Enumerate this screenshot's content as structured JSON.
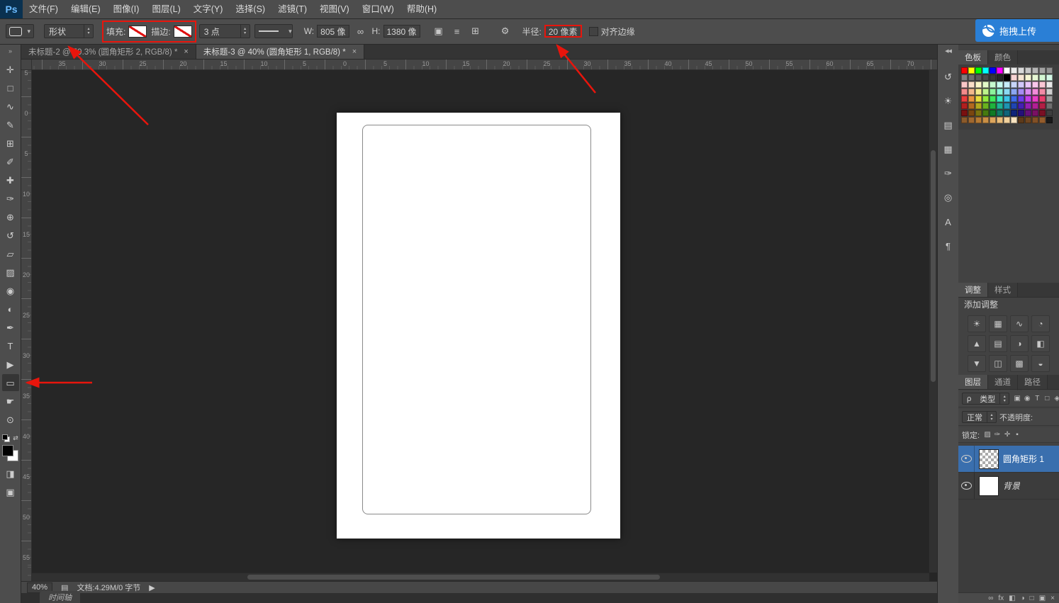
{
  "app": {
    "logo": "Ps",
    "upload_label": "拖拽上传"
  },
  "menu_bar": {
    "items": [
      "文件(F)",
      "编辑(E)",
      "图像(I)",
      "图层(L)",
      "文字(Y)",
      "选择(S)",
      "滤镜(T)",
      "视图(V)",
      "窗口(W)",
      "帮助(H)"
    ]
  },
  "options_bar": {
    "mode_value": "形状",
    "fill_label": "填充:",
    "stroke_label": "描边:",
    "stroke_width_value": "3 点",
    "width_label": "W:",
    "width_value": "805 像",
    "link_glyph": "∞",
    "height_label": "H:",
    "height_value": "1380 像",
    "combine_glyph": "▣",
    "align_glyph": "≡",
    "arrange_glyph": "⊞",
    "gear_glyph": "⚙",
    "radius_label": "半径:",
    "radius_value": "20 像素",
    "align_edges_label": "对齐边缘"
  },
  "document_tabs": [
    {
      "title": "未标题-2 @ 59.3% (圆角矩形 2, RGB/8) *",
      "close": "×",
      "bg": "#383838",
      "color": "#a6a6a6"
    },
    {
      "title": "未标题-3 @ 40% (圆角矩形 1, RGB/8) *",
      "close": "×",
      "bg": "#4d4d4d",
      "color": "#dcdcdc"
    }
  ],
  "toolbar": {
    "collapse_glyph": "»",
    "tools": [
      {
        "name": "move-tool",
        "glyph": "✛"
      },
      {
        "name": "rectangular-marquee-tool",
        "glyph": "□"
      },
      {
        "name": "lasso-tool",
        "glyph": "∿"
      },
      {
        "name": "quick-selection-tool",
        "glyph": "✎"
      },
      {
        "name": "crop-tool",
        "glyph": "⊞"
      },
      {
        "name": "eyedropper-tool",
        "glyph": "✐"
      },
      {
        "name": "healing-brush-tool",
        "glyph": "✚"
      },
      {
        "name": "brush-tool",
        "glyph": "✑"
      },
      {
        "name": "clone-stamp-tool",
        "glyph": "⊕"
      },
      {
        "name": "history-brush-tool",
        "glyph": "↺"
      },
      {
        "name": "eraser-tool",
        "glyph": "▱"
      },
      {
        "name": "gradient-tool",
        "glyph": "▨"
      },
      {
        "name": "blur-tool",
        "glyph": "◉"
      },
      {
        "name": "dodge-tool",
        "glyph": "◐"
      },
      {
        "name": "pen-tool",
        "glyph": "✒"
      },
      {
        "name": "type-tool",
        "glyph": "T"
      },
      {
        "name": "path-selection-tool",
        "glyph": "▶"
      },
      {
        "name": "rounded-rectangle-tool",
        "glyph": "▭",
        "bg": "#353535"
      },
      {
        "name": "hand-tool",
        "glyph": "☛"
      },
      {
        "name": "zoom-tool",
        "glyph": "⊙"
      }
    ],
    "bottom_tools": [
      {
        "name": "quick-mask-button",
        "glyph": "◨"
      },
      {
        "name": "screen-mode-button",
        "glyph": "▣"
      }
    ]
  },
  "rulers": {
    "horizontal": [
      "35",
      "30",
      "25",
      "20",
      "15",
      "10",
      "5",
      "0",
      "5",
      "10",
      "15",
      "20",
      "25",
      "30",
      "35",
      "40",
      "45",
      "50",
      "55",
      "60",
      "65",
      "70"
    ],
    "vertical": [
      "5",
      "0",
      "5",
      "10",
      "15",
      "20",
      "25",
      "30",
      "35",
      "40",
      "45",
      "50",
      "55"
    ]
  },
  "right_rail": {
    "expand_glyph": "◀◀",
    "icons": [
      {
        "name": "history-panel-icon",
        "glyph": "↺"
      },
      {
        "name": "properties-panel-icon",
        "glyph": "☀"
      },
      {
        "name": "info-panel-icon",
        "glyph": "▤"
      },
      {
        "name": "actions-panel-icon",
        "glyph": "▦"
      },
      {
        "name": "brush-panel-icon",
        "glyph": "✑"
      },
      {
        "name": "clone-source-panel-icon",
        "glyph": "◎"
      },
      {
        "name": "character-panel-icon",
        "glyph": "A"
      },
      {
        "name": "paragraph-panel-icon",
        "glyph": "¶"
      }
    ]
  },
  "panels": {
    "swatches": {
      "tabs": [
        "色板",
        "颜色"
      ],
      "colors": [
        "#ff0000",
        "#ffff00",
        "#00ff00",
        "#00ffff",
        "#0000ff",
        "#ff00ff",
        "#ffffff",
        "#ebebeb",
        "#d9d9d9",
        "#c7c7c7",
        "#b5b5b5",
        "#a3a3a3",
        "#919191",
        "#7f7f7f",
        "#6d6d6d",
        "#5b5b5b",
        "#494949",
        "#373737",
        "#252525",
        "#000000",
        "#f7d4d4",
        "#f7e6d4",
        "#f7f7d4",
        "#e6f7d4",
        "#d4f7d4",
        "#d4f7e6",
        "#f9c7c7",
        "#f9dec7",
        "#f9f5c7",
        "#e2f9c7",
        "#c7f9cf",
        "#c7f9ef",
        "#c7ecf9",
        "#c7d4f9",
        "#d2c7f9",
        "#eac7f9",
        "#f9c7ec",
        "#f9c7d4",
        "#e8e8e8",
        "#f28b8b",
        "#f2b88b",
        "#f2ea8b",
        "#bdf28b",
        "#8bf29c",
        "#8bf2d9",
        "#8bd9f2",
        "#8ba6f2",
        "#a68bf2",
        "#d98bf2",
        "#f28bd9",
        "#f28ba6",
        "#cfcfcf",
        "#e83e3e",
        "#e8933e",
        "#e8dc3e",
        "#93e83e",
        "#3ee85d",
        "#3ee8c4",
        "#3ec4e8",
        "#3e6ce8",
        "#6c3ee8",
        "#c43ee8",
        "#e83ec4",
        "#e83e6c",
        "#9e9e9e",
        "#b21f1f",
        "#b2691f",
        "#b2a81f",
        "#69b21f",
        "#1fb23e",
        "#1fb294",
        "#1f94b2",
        "#1f45b2",
        "#451fb2",
        "#941fb2",
        "#b21f94",
        "#b21f45",
        "#6e6e6e",
        "#7a1010",
        "#7a4610",
        "#7a7210",
        "#467a10",
        "#107a24",
        "#107a64",
        "#10647a",
        "#10247a",
        "#24107a",
        "#64107a",
        "#7a1064",
        "#7a1024",
        "#3e3e3e",
        "#8b5a2b",
        "#a0682f",
        "#b57933",
        "#c98f45",
        "#dca55c",
        "#e8bc7a",
        "#f0d09c",
        "#f7e3c0",
        "#5c3a1a",
        "#6e4520",
        "#815026",
        "#945c2c",
        "#1a1a1a"
      ]
    },
    "adjustments": {
      "tab_adjust": "调整",
      "tab_styles": "样式",
      "add_label": "添加调整",
      "icons": [
        {
          "name": "brightness-contrast-icon",
          "glyph": "☀"
        },
        {
          "name": "levels-icon",
          "glyph": "▦"
        },
        {
          "name": "curves-icon",
          "glyph": "∿"
        },
        {
          "name": "exposure-icon",
          "glyph": "◔"
        },
        {
          "name": "vibrance-icon",
          "glyph": "▲"
        },
        {
          "name": "hue-saturation-icon",
          "glyph": "▤"
        },
        {
          "name": "color-balance-icon",
          "glyph": "◑"
        },
        {
          "name": "black-white-icon",
          "glyph": "◧"
        },
        {
          "name": "photo-filter-icon",
          "glyph": "▼"
        },
        {
          "name": "channel-mixer-icon",
          "glyph": "◫"
        },
        {
          "name": "color-lookup-icon",
          "glyph": "▩"
        },
        {
          "name": "invert-icon",
          "glyph": "◒"
        },
        {
          "name": "posterize-icon",
          "glyph": "▨"
        },
        {
          "name": "threshold-icon",
          "glyph": "◓"
        },
        {
          "name": "selective-color-icon",
          "glyph": "▧"
        }
      ]
    },
    "layers": {
      "tab_layers": "图层",
      "tab_channels": "通道",
      "tab_paths": "路径",
      "filter_prefix": "ρ",
      "filter_label": "类型",
      "filter_icons": [
        {
          "name": "filter-pixel-layers-icon",
          "glyph": "▣"
        },
        {
          "name": "filter-adjustment-layers-icon",
          "glyph": "◉"
        },
        {
          "name": "filter-type-layers-icon",
          "glyph": "T"
        },
        {
          "name": "filter-shape-layers-icon",
          "glyph": "□"
        },
        {
          "name": "filter-smart-objects-icon",
          "glyph": "◈"
        }
      ],
      "blend_mode": "正常",
      "opacity_label": "不透明度:",
      "lock_label": "锁定:",
      "lock_icons": [
        {
          "name": "lock-transparency-icon",
          "glyph": "▨"
        },
        {
          "name": "lock-pixels-icon",
          "glyph": "✑"
        },
        {
          "name": "lock-position-icon",
          "glyph": "✛"
        },
        {
          "name": "lock-all-icon",
          "glyph": "▪"
        }
      ],
      "rows": [
        {
          "label": "圆角矩形 1",
          "bg": "#3a6fae",
          "color": "#ffffff",
          "font": "normal",
          "thumb": "repeating-conic-gradient(#ababab 0% 25%, #ffffff 0% 50%) 0% 0% / 8px 8px"
        },
        {
          "label": "背景",
          "bg": "transparent",
          "color": "#d6d6d6",
          "font": "italic",
          "thumb": "#ffffff"
        }
      ],
      "bottom_icons": [
        {
          "name": "link-layers-icon",
          "glyph": "∞"
        },
        {
          "name": "layer-style-icon",
          "glyph": "fx"
        },
        {
          "name": "add-layer-mask-icon",
          "glyph": "◧"
        },
        {
          "name": "new-adjustment-layer-icon",
          "glyph": "◑"
        },
        {
          "name": "new-group-icon",
          "glyph": "□"
        },
        {
          "name": "new-layer-icon",
          "glyph": "▣"
        },
        {
          "name": "delete-layer-icon",
          "glyph": "×"
        }
      ]
    }
  },
  "status_bar": {
    "zoom": "40%",
    "disk_glyph": "▤",
    "doc_info": "文档:4.29M/0 字节",
    "flyout_glyph": "▶"
  },
  "timeline": {
    "label": "时间轴"
  }
}
